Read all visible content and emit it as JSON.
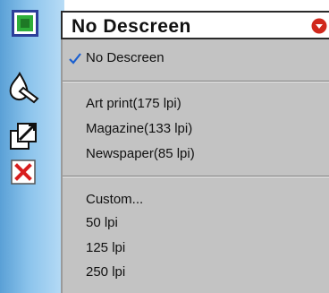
{
  "toolbar": {
    "tools": [
      {
        "icon": "green-square-view-icon"
      },
      {
        "icon": "paint-drop-icon"
      },
      {
        "icon": "crop-tool-icon"
      },
      {
        "icon": "red-x-close-icon"
      }
    ]
  },
  "descreen": {
    "selected": "No Descreen",
    "options": [
      {
        "label": "No Descreen",
        "checked": true
      },
      {
        "label": "Art print(175 lpi)"
      },
      {
        "label": "Magazine(133 lpi)"
      },
      {
        "label": "Newspaper(85 lpi)"
      },
      {
        "label": "Custom..."
      },
      {
        "label": "50 lpi"
      },
      {
        "label": "125 lpi"
      },
      {
        "label": "250 lpi"
      }
    ]
  },
  "colors": {
    "menu_bg": "#c3c3c3",
    "check": "#1a5fd0",
    "dropdown_arrow": "#d0281c",
    "close_red": "#d81e1e",
    "view_green": "#2fae3a"
  }
}
